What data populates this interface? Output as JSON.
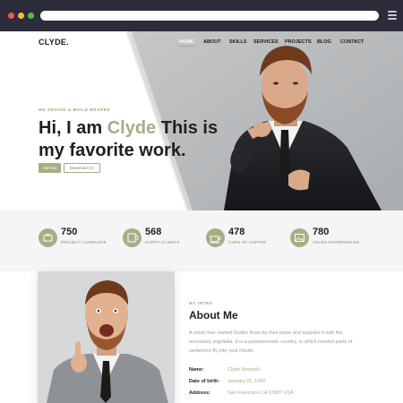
{
  "site": {
    "logo": "CLYDE.",
    "nav": [
      "HOME",
      "ABOUT",
      "SKILLS",
      "SERVICES",
      "PROJECTS",
      "BLOG",
      "CONTACT"
    ],
    "active_nav": "HOME"
  },
  "hero": {
    "tagline": "WE DESIGN & BUILD BRANDS",
    "headline_pre": "Hi, I am ",
    "headline_name": "Clyde",
    "headline_post": " This is my favorite work.",
    "hire_button": "Hire me",
    "cv_button": "Download CV"
  },
  "stats": [
    {
      "number": "750",
      "label": "PROJECT COMPLETE",
      "icon": "briefcase-icon"
    },
    {
      "number": "568",
      "label": "HAPPY CLIENTS",
      "icon": "mug-icon"
    },
    {
      "number": "478",
      "label": "CUPS OF COFFEE",
      "icon": "coffee-icon"
    },
    {
      "number": "780",
      "label": "YEARS EXPERIENCED",
      "icon": "photo-icon"
    }
  ],
  "about": {
    "kicker": "MY INTRO",
    "title": "About Me",
    "body": "A small river named Duden flows by their place and supplies it with the necessary regelialia. It is a paradisematic country, in which roasted parts of sentences fly into your mouth.",
    "info": [
      {
        "key": "Name:",
        "value": "Clyde Nowitzki"
      },
      {
        "key": "Date of birth:",
        "value": "January 01, 1990"
      },
      {
        "key": "Address:",
        "value": "San Francisco CA 97987 USA"
      }
    ]
  },
  "colors": {
    "accent": "#a9ad84",
    "chrome": "#2d2c3a",
    "hero_gray": "#b9bcbe",
    "stats_bg": "#f4f5f7"
  }
}
